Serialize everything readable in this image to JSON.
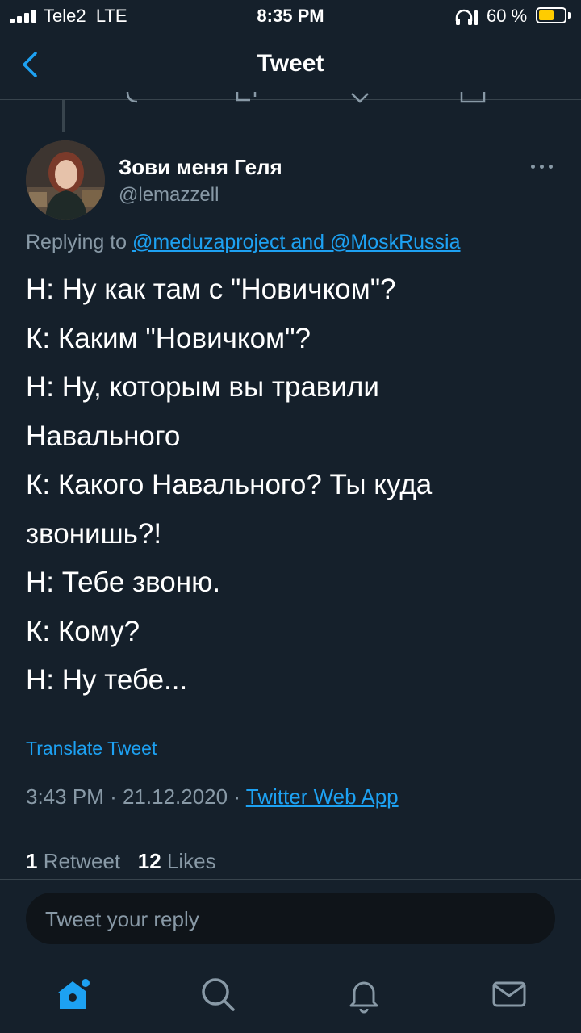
{
  "status_bar": {
    "carrier": "Tele2",
    "network": "LTE",
    "time": "8:35 PM",
    "battery_percent": "60 %",
    "battery_level": 0.6,
    "battery_color": "#ffcc00"
  },
  "header": {
    "title": "Tweet",
    "back_icon": "chevron-left-icon"
  },
  "tweet": {
    "author": {
      "display_name": "Зови меня Геля",
      "username": "@lemazzell"
    },
    "replying_prefix": "Replying to",
    "replying_to": "@meduzaproject and @MoskRussia",
    "lines": [
      "Н: Ну как там с \"Новичком\"?",
      "К: Каким \"Новичком\"?",
      "Н: Ну, которым вы травили",
      "Навального",
      "К: Какого Навального? Ты куда",
      "звонишь?!",
      "Н: Тебе звоню.",
      "К: Кому?",
      "Н: Ну тебе..."
    ],
    "translate_label": "Translate Tweet",
    "time": "3:43 PM",
    "date": "21.12.2020",
    "separator": "·",
    "source": "Twitter Web App"
  },
  "stats": {
    "retweets_count": "1",
    "retweets_label": "Retweet",
    "likes_count": "12",
    "likes_label": "Likes"
  },
  "reply": {
    "placeholder": "Tweet your reply"
  },
  "tab_bar": {
    "items": [
      "home-icon",
      "search-icon",
      "notifications-icon",
      "messages-icon"
    ],
    "active": "home-icon",
    "active_color": "#1da1f2",
    "inactive_color": "#8899a6"
  },
  "colors": {
    "background": "#15202b",
    "accent": "#1da1f2",
    "secondary_text": "#8899a6",
    "divider": "#38444d"
  }
}
